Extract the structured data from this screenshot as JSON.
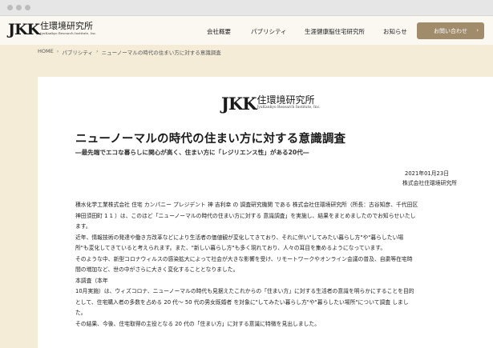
{
  "header": {
    "logo_mark": "JKK",
    "logo_jp": "住環境研究所",
    "logo_en": "JyuKankyo Research Institute, Inc.",
    "nav": [
      "会社概要",
      "パブリシティ",
      "生涯健康脳住宅研究所",
      "お知らせ"
    ],
    "contact_label": "お問い合わせ"
  },
  "breadcrumb": [
    "HOME",
    "パブリシティ",
    "ニューノーマルの時代の住まい方に対する意識調査"
  ],
  "article": {
    "logo_mark": "JKK",
    "logo_jp": "住環境研究所",
    "logo_en": "JyuKankyo Research Institute, Inc.",
    "title": "ニューノーマルの時代の住まい方に対する意識調査",
    "subtitle": "―最先端でエコな暮らしに関心が高く、住まい方に「レジリエンス性」がある20代―",
    "date": "2021年01月23日",
    "org": "株式会社住環境研究所",
    "lines": [
      "積水化学工業株式会社 住宅 カンパニー プレジデント 神 吉利幸 の 調査研究機関 である 株式会社住環境研究所（所長：古谷知彦、千代田区",
      "神田須田町 1 1 ）は、このほど「ニューノーマルの時代の住まい方に対する 意識調査」を実施し、結果をまとめましたのでお知らせいたし",
      "ます。",
      "近年、情報技術の発達や働き方改革などにより生活者の価値観が変化してきており、それに伴い\"してみたい暮らし方\"や\"暮らしたい場",
      "所\"も変化してきていると考えられます。また、\"新しい暮らし方\"も多く現れており、人々の耳目を集めるようになっています。",
      "そのような中、新型コロナウィルスの感染拡大によって社会が大きな影響を受け、リモートワークやオンライン会議の普及、自粛等在宅時",
      "間の増加など、世の中がさらに大きく変化することとなりました。",
      "本調査（本年",
      "10月実施）は、ウィズコロナ、ニューノーマルの時代も見据えたこれからの「住まい方」に対する生活者の意識を明らかにすることを目的",
      "として、住宅購入者の多数を占める 20 代～ 50 代の男女既婚者 を対象に\"してみたい暮らし方\"や\"暮らしたい場所\"について調査 しまし",
      "た。",
      "その結果、今後、住宅取得の主役となる 20 代の「住まい方」に対する意識に特徴を見出しました。"
    ]
  }
}
